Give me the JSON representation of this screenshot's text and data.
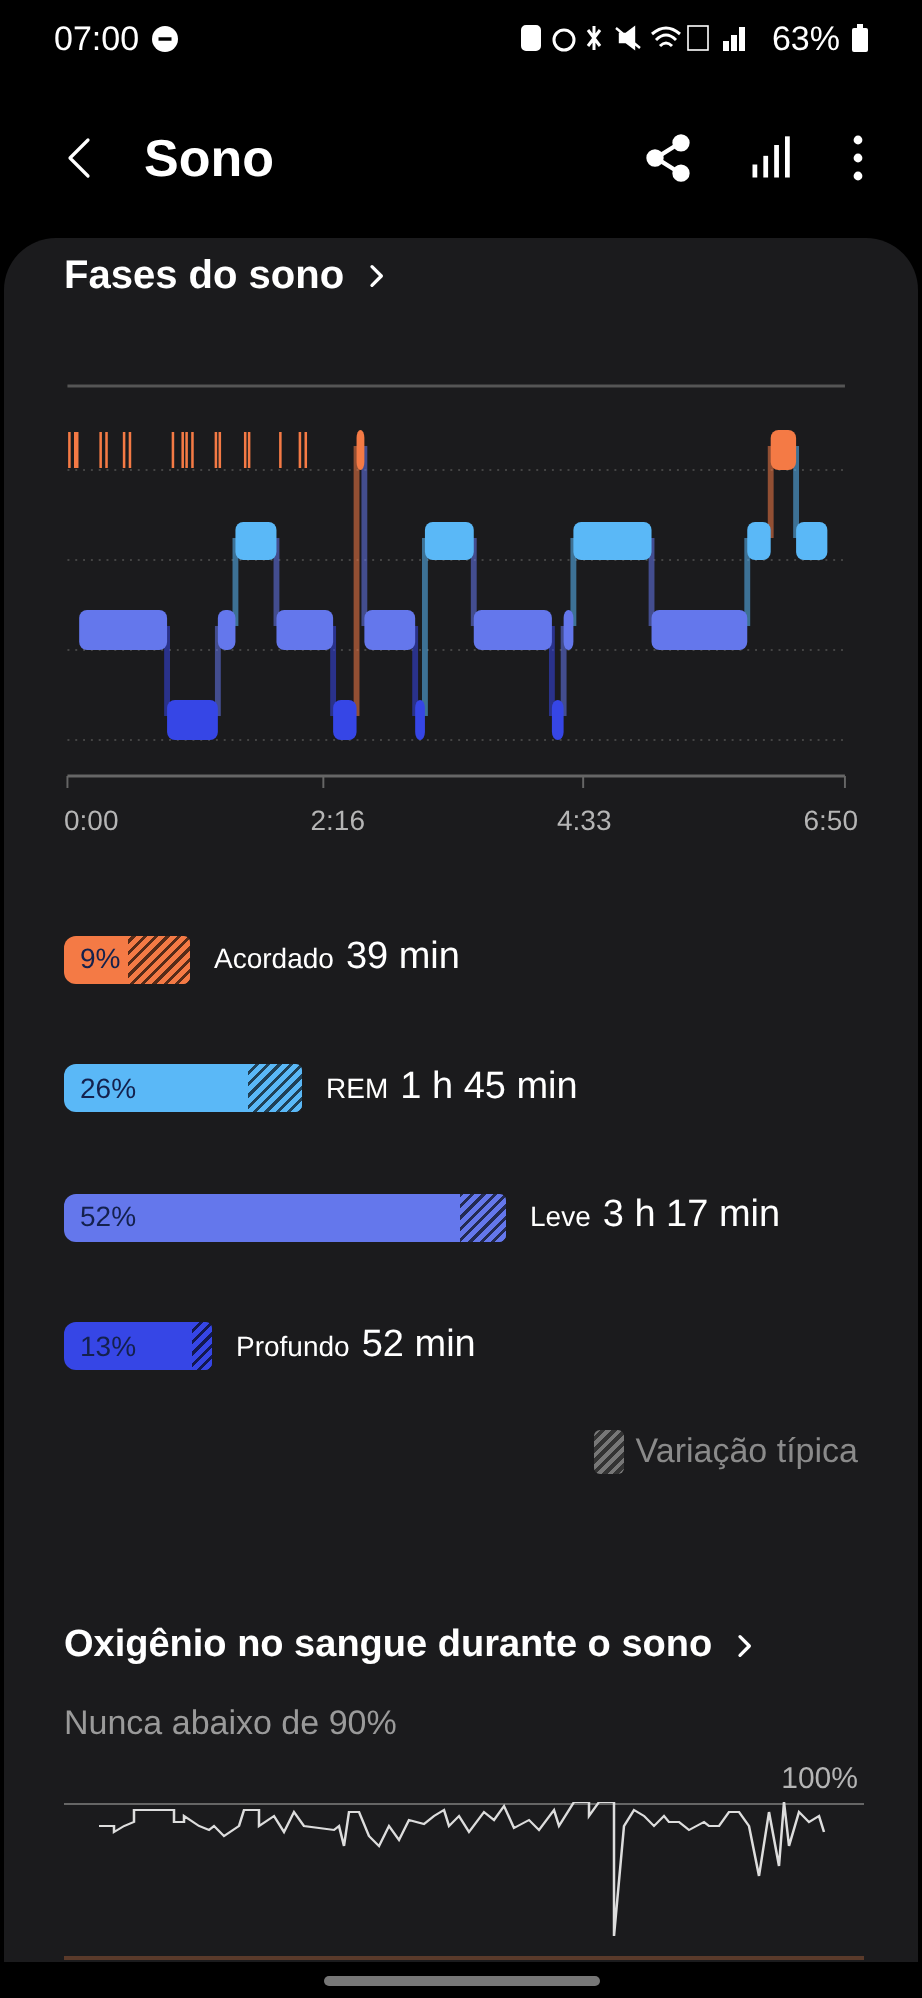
{
  "status_bar": {
    "time": "07:00",
    "battery": "63%"
  },
  "header": {
    "title": "Sono"
  },
  "phases": {
    "title": "Fases do sono",
    "axis_labels": [
      "0:00",
      "2:16",
      "4:33",
      "6:50"
    ],
    "stages": [
      {
        "percent": "9%",
        "name": "Acordado",
        "duration": "39 min",
        "color": "#f47a45"
      },
      {
        "percent": "26%",
        "name": "REM",
        "duration": "1 h 45 min",
        "color": "#5ab8f7"
      },
      {
        "percent": "52%",
        "name": "Leve",
        "duration": "3 h 17 min",
        "color": "#6477ec"
      },
      {
        "percent": "13%",
        "name": "Profundo",
        "duration": "52 min",
        "color": "#3646e6"
      }
    ],
    "legend": "Variação típica"
  },
  "oxygen": {
    "title": "Oxigênio no sangue durante o sono",
    "subtitle": "Nunca abaixo de 90%",
    "top_label": "100%"
  }
}
